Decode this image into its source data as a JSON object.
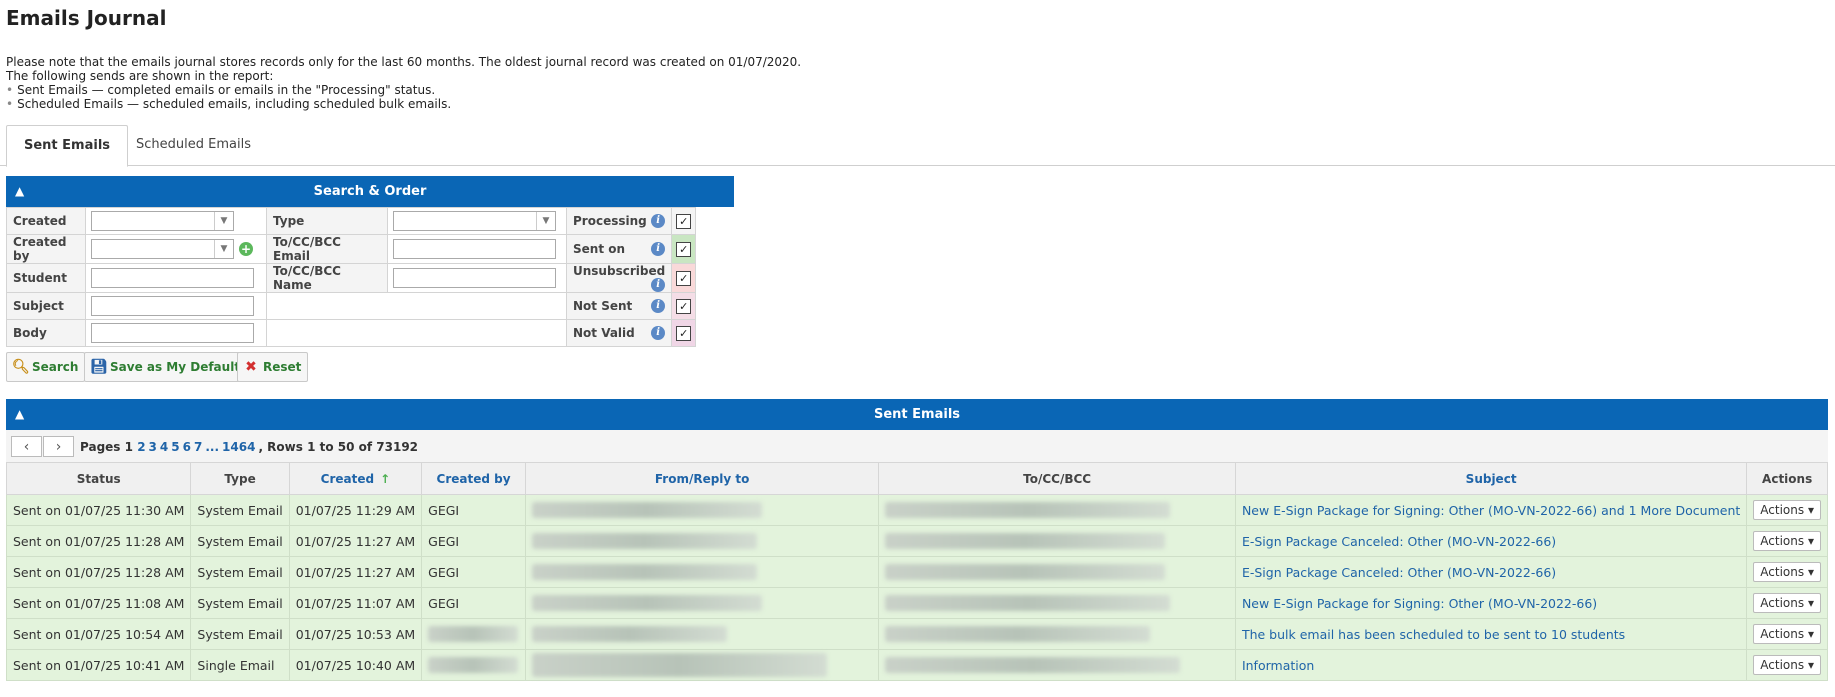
{
  "title": "Emails Journal",
  "notes": [
    "Please note that the emails journal stores records only for the last 60 months. The oldest journal record was created on 01/07/2020.",
    "The following sends are shown in the report:",
    "Sent Emails — completed emails or emails in the \"Processing\" status.",
    "Scheduled Emails — scheduled emails, including scheduled bulk emails."
  ],
  "tabs": {
    "sent": "Sent Emails",
    "scheduled": "Scheduled Emails"
  },
  "search": {
    "header": "Search & Order",
    "labels": {
      "created": "Created",
      "created_by": "Created by",
      "student": "Student",
      "subject": "Subject",
      "body": "Body",
      "type": "Type",
      "to_email": "To/CC/BCC Email",
      "to_name": "To/CC/BCC Name",
      "processing": "Processing",
      "sent_on": "Sent on",
      "unsubscribed": "Unsubscribed",
      "not_sent": "Not Sent",
      "not_valid": "Not Valid"
    },
    "buttons": {
      "search": "Search",
      "save_default": "Save as My Default",
      "reset": "Reset"
    }
  },
  "results": {
    "header": "Sent Emails",
    "pager": {
      "pages_label": "Pages",
      "current": "1",
      "pages": [
        "2",
        "3",
        "4",
        "5",
        "6",
        "7",
        "...",
        "1464"
      ],
      "rows": ", Rows 1 to 50 of 73192"
    },
    "columns": [
      "Status",
      "Type",
      "Created",
      "Created by",
      "From/Reply to",
      "To/CC/BCC",
      "Subject",
      "Actions"
    ],
    "rows": [
      {
        "status": "Sent on 01/07/25 11:30 AM",
        "type": "System Email",
        "created": "01/07/25 11:29 AM",
        "created_by": "GEGI",
        "subject": "New E-Sign Package for Signing: Other (MO-VN-2022-66) and 1 More Document",
        "actions": "Actions"
      },
      {
        "status": "Sent on 01/07/25 11:28 AM",
        "type": "System Email",
        "created": "01/07/25 11:27 AM",
        "created_by": "GEGI",
        "subject": "E-Sign Package Canceled: Other (MO-VN-2022-66)",
        "actions": "Actions"
      },
      {
        "status": "Sent on 01/07/25 11:28 AM",
        "type": "System Email",
        "created": "01/07/25 11:27 AM",
        "created_by": "GEGI",
        "subject": "E-Sign Package Canceled: Other (MO-VN-2022-66)",
        "actions": "Actions"
      },
      {
        "status": "Sent on 01/07/25 11:08 AM",
        "type": "System Email",
        "created": "01/07/25 11:07 AM",
        "created_by": "GEGI",
        "subject": "New E-Sign Package for Signing: Other (MO-VN-2022-66)",
        "actions": "Actions"
      },
      {
        "status": "Sent on 01/07/25 10:54 AM",
        "type": "System Email",
        "created": "01/07/25 10:53 AM",
        "created_by": "",
        "subject": "The bulk email has been scheduled to be sent to 10 students",
        "actions": "Actions"
      },
      {
        "status": "Sent on 01/07/25 10:41 AM",
        "type": "Single Email",
        "created": "01/07/25 10:40 AM",
        "created_by": "",
        "subject": "Information",
        "actions": "Actions"
      }
    ]
  }
}
